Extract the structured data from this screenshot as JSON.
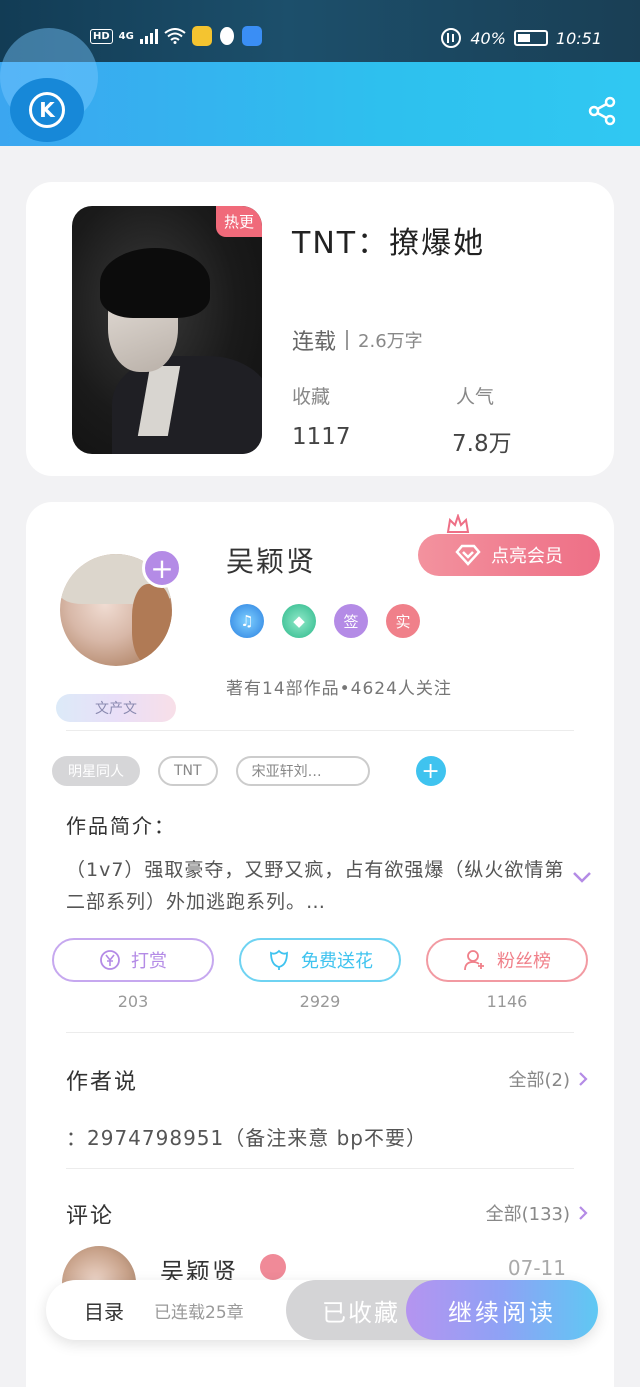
{
  "status_bar": {
    "hd": "HD",
    "network": "4G",
    "battery": "40%",
    "time": "10:51"
  },
  "book": {
    "hot_tag": "热更",
    "title": "TNT：撩爆她",
    "status": "连载",
    "word_count": "2.6万字",
    "favorites_label": "收藏",
    "favorites_value": "1117",
    "popularity_label": "人气",
    "popularity_value": "7.8万"
  },
  "author": {
    "name": "吴颖贤",
    "vip_button": "点亮会员",
    "badge_sign": "签",
    "badge_real": "实",
    "deco_tag": "文产文",
    "meta": "著有14部作品•4624人关注"
  },
  "tags": [
    "明星同人",
    "TNT",
    "宋亚轩刘…"
  ],
  "intro": {
    "title": "作品简介：",
    "text": "（1v7）强取豪夺，又野又疯，占有欲强爆（纵火欲情第二部系列）外加逃跑系列。…"
  },
  "actions": {
    "reward_label": "打赏",
    "reward_count": "203",
    "flower_label": "免费送花",
    "flower_count": "2929",
    "fans_label": "粉丝榜",
    "fans_count": "1146"
  },
  "author_says": {
    "title": "作者说",
    "more": "全部(2)",
    "text": "：2974798951（备注来意 bp不要）"
  },
  "comments": {
    "title": "评论",
    "more": "全部(133)",
    "first_name": "吴颖贤",
    "first_date": "07-11"
  },
  "bottom_bar": {
    "toc": "目录",
    "serial": "已连载25章",
    "favorited": "已收藏",
    "continue_reading": "继续阅读"
  },
  "colors": {
    "header_accent": "#2ec0ee",
    "vip_pink": "#ee6f86",
    "reward_purple": "#b48be6",
    "flower_cyan": "#3fc3ef",
    "fans_red": "#f0808a"
  }
}
